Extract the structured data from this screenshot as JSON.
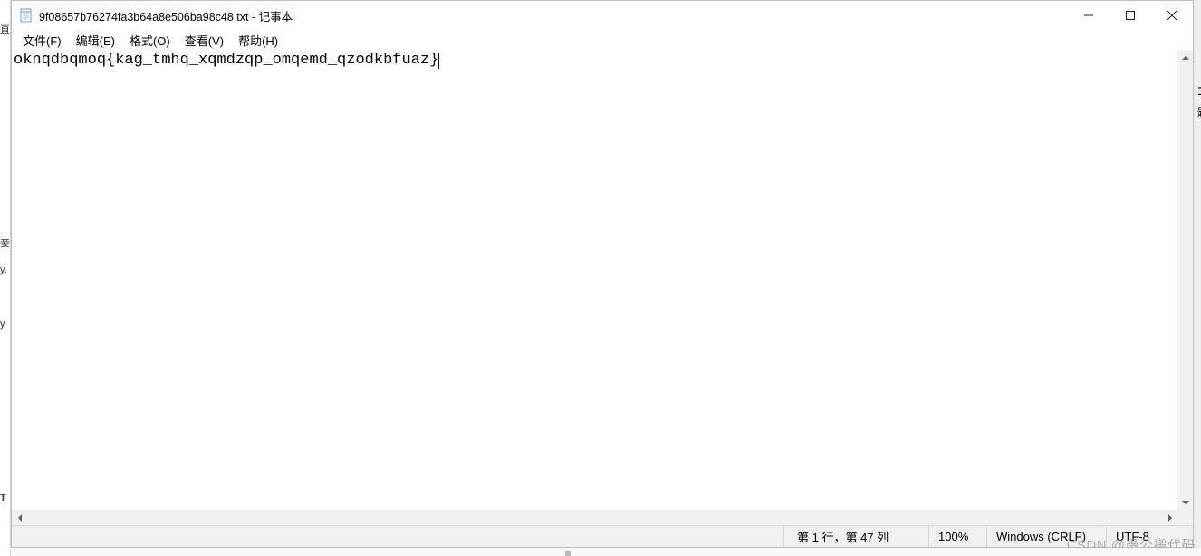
{
  "window": {
    "title": "9f08657b76274fa3b64a8e506ba98c48.txt - 记事本"
  },
  "menus": {
    "file": "文件(F)",
    "edit": "编辑(E)",
    "format": "格式(O)",
    "view": "查看(V)",
    "help": "帮助(H)"
  },
  "editor": {
    "content": "oknqdbqmoq{kag_tmhq_xqmdzqp_omqemd_qzodkbfuaz}"
  },
  "status": {
    "position": "第 1 行，第 47 列",
    "zoom": "100%",
    "eol": "Windows (CRLF)",
    "encoding": "UTF-8"
  },
  "watermark": "CSDN @愚公搬代码",
  "left_sliver": {
    "c1": "直",
    "c2": "妾",
    "c3": "y,",
    "c4": "y",
    "c5": "T"
  },
  "right_sliver": {
    "c1": "☰",
    "c2": "题"
  }
}
